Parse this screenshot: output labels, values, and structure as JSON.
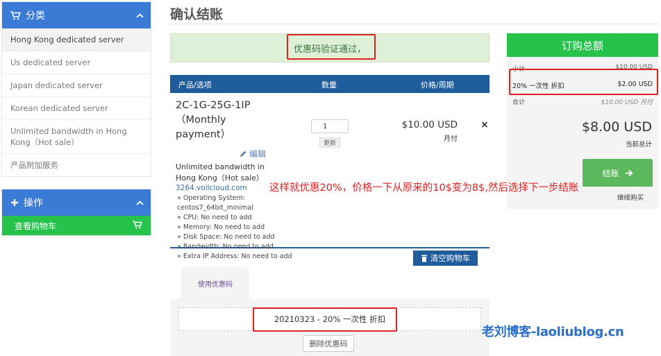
{
  "page_title": "确认结账",
  "sidebar": {
    "category": {
      "title": "分类",
      "items": [
        {
          "label": "Hong Kong dedicated server"
        },
        {
          "label": "Us dedicated server"
        },
        {
          "label": "Japan dedicated server"
        },
        {
          "label": "Korean dedicated server"
        },
        {
          "label": "Unlimited bandwidth in Hong Kong（Hot sale）"
        },
        {
          "label": "产品附加服务"
        }
      ]
    },
    "actions": {
      "title": "操作",
      "view_cart": "查看购物车"
    }
  },
  "alert": {
    "text": "优惠码验证通过，"
  },
  "cart": {
    "headers": {
      "product": "产品/选项",
      "qty": "数量",
      "price": "价格/周期"
    },
    "item": {
      "name": "2C-1G-25G-1IP（Monthly payment）",
      "edit": "编辑",
      "group": "Unlimited bandwidth in Hong Kong（Hot sale）",
      "domain": "3264.vollcloud.com",
      "config": [
        "» Operating System:",
        "centos7_64bit_minimal",
        "» CPU: No need to add",
        "» Memory: No need to add",
        "» Disk Space: No need to add",
        "» Bandwidth: No need to add",
        "» Extra IP Address: No need to add"
      ],
      "qty": "1",
      "update": "更新",
      "price": "$10.00 USD",
      "cycle": "月付",
      "remove": "×"
    },
    "empty_cart": "清空购物车"
  },
  "promo": {
    "tab": "使用优惠码",
    "code": "20210323 - 20% 一次性 折扣",
    "remove": "删除优惠码"
  },
  "summary": {
    "title": "订购总额",
    "subtotal_label": "小计",
    "subtotal": "$10.00 USD",
    "discount_label": "20% 一次性 折扣",
    "discount": "$2.00 USD",
    "tax_label": "合计",
    "tax": "$10.00 USD 月付",
    "total": "$8.00 USD",
    "total_label": "当前总计",
    "checkout": "结账",
    "continue": "继续购买"
  },
  "annotation": {
    "note": "这样就优惠20%，价格一下从原来的10$变为8$,然后选择下一步结账"
  },
  "watermark": "老刘博客-laoliublog.cn",
  "colors": {
    "sidebar_header": "#3a7bd5",
    "accent_green": "#27c24c",
    "checkout_green": "#5cb85c",
    "table_header": "#1f5c9c",
    "alert_bg": "#dff0d8",
    "annotation_red": "#e02020",
    "watermark_blue": "#2b6fc9"
  }
}
